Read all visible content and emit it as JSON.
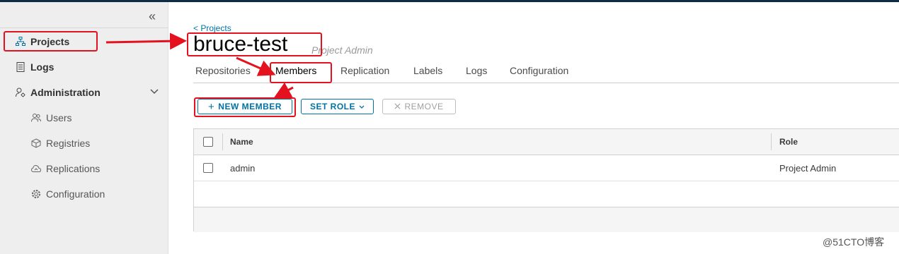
{
  "sidebar": {
    "items": [
      {
        "label": "Projects",
        "icon": "projects-icon"
      },
      {
        "label": "Logs",
        "icon": "logs-icon"
      },
      {
        "label": "Administration",
        "icon": "administration-icon"
      }
    ],
    "admin_children": [
      {
        "label": "Users",
        "icon": "users-icon"
      },
      {
        "label": "Registries",
        "icon": "registries-icon"
      },
      {
        "label": "Replications",
        "icon": "replications-icon"
      },
      {
        "label": "Configuration",
        "icon": "configuration-icon"
      }
    ]
  },
  "header": {
    "breadcrumb": "< Projects",
    "title": "bruce-test",
    "role": "Project Admin"
  },
  "tabs": [
    "Repositories",
    "Members",
    "Replication",
    "Labels",
    "Logs",
    "Configuration"
  ],
  "toolbar": {
    "new_member": "NEW MEMBER",
    "set_role": "SET ROLE",
    "remove": "REMOVE"
  },
  "table": {
    "columns": [
      "Name",
      "Role"
    ],
    "rows": [
      {
        "name": "admin",
        "role": "Project Admin"
      }
    ]
  },
  "watermark": "@51CTO博客",
  "colors": {
    "accent": "#0072a3",
    "annotation": "#e3121e",
    "topbar": "#0c2d48"
  }
}
